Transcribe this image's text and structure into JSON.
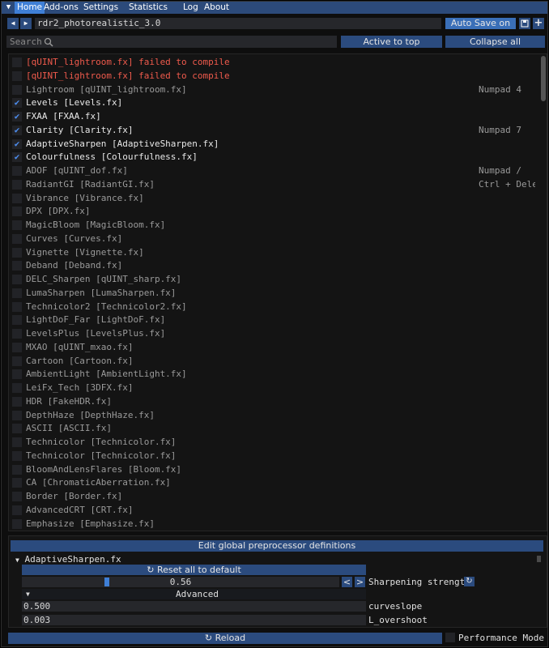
{
  "menubar": {
    "items": [
      "Home",
      "Add-ons",
      "Settings",
      "Statistics",
      "Log",
      "About"
    ],
    "active": "Home"
  },
  "toolbar": {
    "preset_name": "rdr2_photorealistic_3.0",
    "auto_save_label": "Auto Save on",
    "save_icon": "save-icon",
    "add_icon": "plus-icon"
  },
  "filter": {
    "search_placeholder": "Search",
    "active_to_top_label": "Active to top",
    "collapse_all_label": "Collapse all"
  },
  "effects": [
    {
      "name": "[qUINT_lightroom.fx] failed to compile",
      "state": "error",
      "checked": false,
      "key": ""
    },
    {
      "name": "[qUINT_lightroom.fx] failed to compile",
      "state": "error",
      "checked": false,
      "key": ""
    },
    {
      "name": "Lightroom [qUINT_lightroom.fx]",
      "state": "off",
      "checked": false,
      "key": "Numpad 4"
    },
    {
      "name": "Levels [Levels.fx]",
      "state": "on",
      "checked": true,
      "key": ""
    },
    {
      "name": "FXAA [FXAA.fx]",
      "state": "on",
      "checked": true,
      "key": ""
    },
    {
      "name": "Clarity [Clarity.fx]",
      "state": "on",
      "checked": true,
      "key": "Numpad 7"
    },
    {
      "name": "AdaptiveSharpen [AdaptiveSharpen.fx]",
      "state": "on",
      "checked": true,
      "key": ""
    },
    {
      "name": "Colourfulness [Colourfulness.fx]",
      "state": "on",
      "checked": true,
      "key": ""
    },
    {
      "name": "ADOF [qUINT_dof.fx]",
      "state": "off",
      "checked": false,
      "key": "Numpad /"
    },
    {
      "name": "RadiantGI [RadiantGI.fx]",
      "state": "off",
      "checked": false,
      "key": "Ctrl + Delete"
    },
    {
      "name": "Vibrance [Vibrance.fx]",
      "state": "off",
      "checked": false,
      "key": ""
    },
    {
      "name": "DPX [DPX.fx]",
      "state": "off",
      "checked": false,
      "key": ""
    },
    {
      "name": "MagicBloom [MagicBloom.fx]",
      "state": "off",
      "checked": false,
      "key": ""
    },
    {
      "name": "Curves [Curves.fx]",
      "state": "off",
      "checked": false,
      "key": ""
    },
    {
      "name": "Vignette [Vignette.fx]",
      "state": "off",
      "checked": false,
      "key": ""
    },
    {
      "name": "Deband [Deband.fx]",
      "state": "off",
      "checked": false,
      "key": ""
    },
    {
      "name": "DELC_Sharpen [qUINT_sharp.fx]",
      "state": "off",
      "checked": false,
      "key": ""
    },
    {
      "name": "LumaSharpen [LumaSharpen.fx]",
      "state": "off",
      "checked": false,
      "key": ""
    },
    {
      "name": "Technicolor2 [Technicolor2.fx]",
      "state": "off",
      "checked": false,
      "key": ""
    },
    {
      "name": "LightDoF_Far [LightDoF.fx]",
      "state": "off",
      "checked": false,
      "key": ""
    },
    {
      "name": "LevelsPlus [LevelsPlus.fx]",
      "state": "off",
      "checked": false,
      "key": ""
    },
    {
      "name": "MXAO [qUINT_mxao.fx]",
      "state": "off",
      "checked": false,
      "key": ""
    },
    {
      "name": "Cartoon [Cartoon.fx]",
      "state": "off",
      "checked": false,
      "key": ""
    },
    {
      "name": "AmbientLight [AmbientLight.fx]",
      "state": "off",
      "checked": false,
      "key": ""
    },
    {
      "name": "LeiFx_Tech [3DFX.fx]",
      "state": "off",
      "checked": false,
      "key": ""
    },
    {
      "name": "HDR [FakeHDR.fx]",
      "state": "off",
      "checked": false,
      "key": ""
    },
    {
      "name": "DepthHaze [DepthHaze.fx]",
      "state": "off",
      "checked": false,
      "key": ""
    },
    {
      "name": "ASCII [ASCII.fx]",
      "state": "off",
      "checked": false,
      "key": ""
    },
    {
      "name": "Technicolor [Technicolor.fx]",
      "state": "off",
      "checked": false,
      "key": ""
    },
    {
      "name": "Technicolor [Technicolor.fx]",
      "state": "off",
      "checked": false,
      "key": ""
    },
    {
      "name": "BloomAndLensFlares [Bloom.fx]",
      "state": "off",
      "checked": false,
      "key": ""
    },
    {
      "name": "CA [ChromaticAberration.fx]",
      "state": "off",
      "checked": false,
      "key": ""
    },
    {
      "name": "Border [Border.fx]",
      "state": "off",
      "checked": false,
      "key": ""
    },
    {
      "name": "AdvancedCRT [CRT.fx]",
      "state": "off",
      "checked": false,
      "key": ""
    },
    {
      "name": "Emphasize [Emphasize.fx]",
      "state": "off",
      "checked": false,
      "key": ""
    }
  ],
  "params": {
    "edit_globals_label": "Edit global preprocessor definitions",
    "section_title": "AdaptiveSharpen.fx",
    "reset_label": "Reset all to default",
    "sharpening_value": "0.56",
    "sharpening_fraction": 0.26,
    "sharpening_label": "Sharpening strength",
    "advanced_label": "Advanced",
    "curveslope_value": "0.500",
    "curveslope_label": "curveslope",
    "overshoot_value": "0.003",
    "overshoot_label": "L_overshoot"
  },
  "footer": {
    "reload_label": "Reload",
    "performance_mode_label": "Performance Mode"
  },
  "colors": {
    "accent": "#3f7fd6",
    "button": "#2b4b7e",
    "error_text": "#ef5a4c",
    "check": "#4d8ef0"
  }
}
